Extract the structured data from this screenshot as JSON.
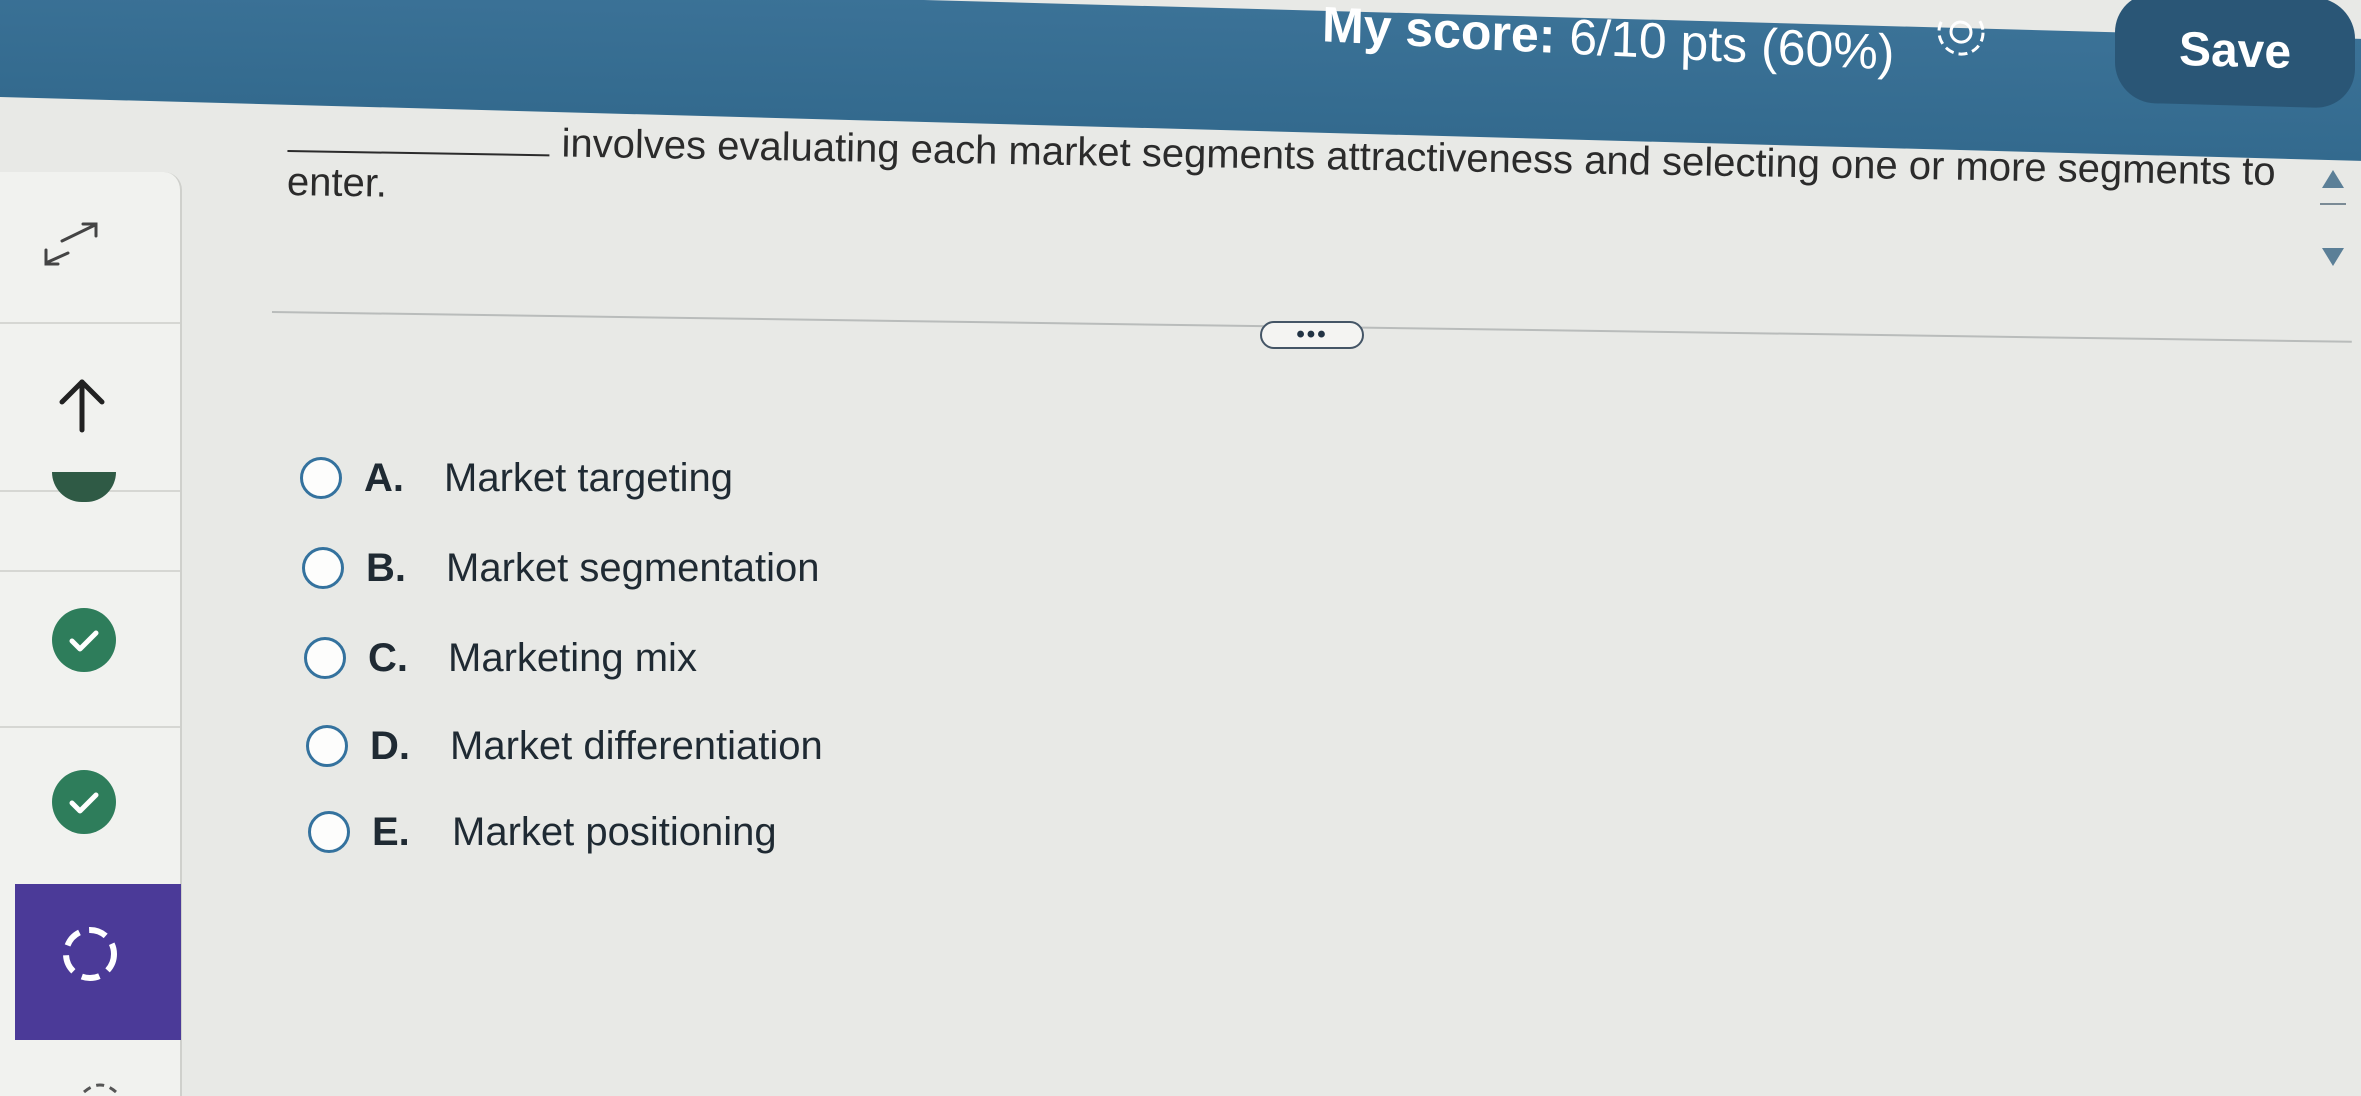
{
  "header": {
    "score_label": "My score:",
    "score_value": "6/10 pts (60%)",
    "save_label": "Save"
  },
  "sidebar": {
    "items": [
      {
        "icon": "expand-icon",
        "state": "action"
      },
      {
        "icon": "up-arrow-icon",
        "state": "action"
      },
      {
        "icon": "question-status-icon",
        "state": "partial"
      },
      {
        "icon": "check-icon",
        "state": "correct"
      },
      {
        "icon": "check-icon",
        "state": "correct"
      },
      {
        "icon": "dashed-circle-icon",
        "state": "current"
      }
    ]
  },
  "question": {
    "text": "involves evaluating each market segments attractiveness and selecting one or more segments to enter."
  },
  "more_label": "•••",
  "options": [
    {
      "letter": "A.",
      "text": "Market targeting"
    },
    {
      "letter": "B.",
      "text": "Market segmentation"
    },
    {
      "letter": "C.",
      "text": "Marketing mix"
    },
    {
      "letter": "D.",
      "text": "Market differentiation"
    },
    {
      "letter": "E.",
      "text": "Market positioning"
    }
  ],
  "colors": {
    "header": "#3b7297",
    "save_button": "#2a5676",
    "correct": "#2e7d5b",
    "current": "#4b3a98",
    "radio_border": "#34729e"
  }
}
